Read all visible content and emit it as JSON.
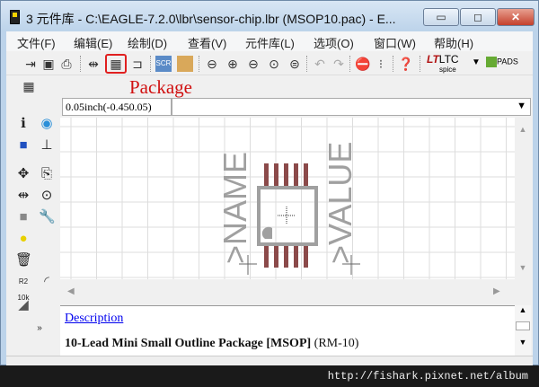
{
  "window": {
    "title": "3 元件库 - C:\\EAGLE-7.2.0\\lbr\\sensor-chip.lbr (MSOP10.pac) - E...",
    "minimize": "▭",
    "maximize": "◻",
    "close": "✕"
  },
  "menu": [
    {
      "label": "文件(F)"
    },
    {
      "label": "编辑(E)"
    },
    {
      "label": "绘制(D)"
    },
    {
      "label": "查看(V)"
    },
    {
      "label": "元件库(L)"
    },
    {
      "label": "选项(O)"
    },
    {
      "label": "窗口(W)"
    },
    {
      "label": "帮助(H)"
    }
  ],
  "toolbar": {
    "ltc_label": "LTC",
    "ltc_sub": "spice",
    "pads_label": "PADS"
  },
  "annotation": {
    "package_label": "Package",
    "color": "#d01010"
  },
  "coordinate": {
    "value": "0.05inch(-0.450.05)"
  },
  "canvas": {
    "name_text": ">NAME",
    "value_text": ">VALUE",
    "pad_color": "#8b4a4a",
    "silk_color": "#a0a0a0"
  },
  "description": {
    "link": "Description",
    "text_bold": "10-Lead Mini Small Outline Package [MSOP]",
    "text_normal": "(RM-10)"
  },
  "watermark": {
    "url": "http://fishark.pixnet.net/album"
  }
}
